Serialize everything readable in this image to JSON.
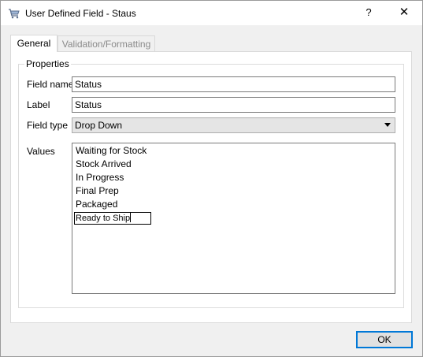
{
  "window": {
    "title": "User Defined Field - Staus",
    "app_icon": "cart-icon",
    "help_label": "?",
    "close_label": "✕"
  },
  "tabs": [
    {
      "label": "General",
      "selected": true
    },
    {
      "label": "Validation/Formatting",
      "selected": false
    }
  ],
  "properties": {
    "group_title": "Properties",
    "field_name": {
      "label": "Field name",
      "value": "Status"
    },
    "label": {
      "label": "Label",
      "value": "Status"
    },
    "field_type": {
      "label": "Field type",
      "value": "Drop Down"
    },
    "values": {
      "label": "Values",
      "items": [
        "Waiting for Stock",
        "Stock Arrived",
        "In Progress",
        "Final Prep",
        "Packaged"
      ],
      "editing_item": "Ready to Ship"
    }
  },
  "buttons": {
    "ok_label": "OK"
  }
}
